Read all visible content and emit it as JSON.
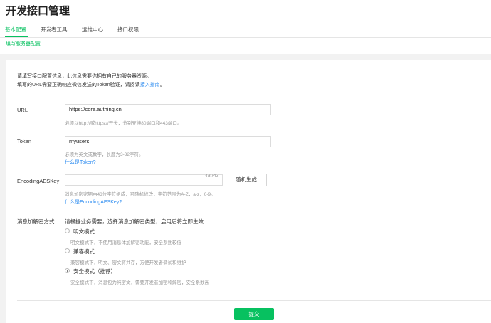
{
  "page": {
    "title": "开发接口管理"
  },
  "tabs": [
    {
      "label": "基本配置"
    },
    {
      "label": "开发者工具"
    },
    {
      "label": "运维中心"
    },
    {
      "label": "接口权限"
    }
  ],
  "subnav": {
    "label": "填写服务器配置"
  },
  "intro": {
    "line1": "请填写接口配置信息，此信息需要你拥有自己的服务器资源。",
    "line2_prefix": "填写的URL需要正确响应微信发送的Token验证，请阅读",
    "line2_link": "接入指南",
    "line2_suffix": "。"
  },
  "url": {
    "label": "URL",
    "value": "https://core.authing.cn",
    "help": "必须以http://或https://开头，分别支持80端口和443端口。"
  },
  "token": {
    "label": "Token",
    "value": "myusers",
    "help": "必须为英文或数字，长度为3-32字符。",
    "link": "什么是Token?"
  },
  "aes": {
    "label": "EncodingAESKey",
    "value": "",
    "count": "43 /43",
    "generate_label": "随机生成",
    "help": "消息加密密钥由43位字符组成，可随机修改，字符范围为A-Z，a-z，0-9。",
    "link": "什么是EncodingAESKey?"
  },
  "encryption": {
    "label": "消息加解密方式",
    "description": "请根据业务需要，选择消息加解密类型，启用后将立即生效",
    "options": [
      {
        "label": "明文模式",
        "help": "明文模式下，不使用消息体加解密功能，安全系数较低",
        "checked": false
      },
      {
        "label": "兼容模式",
        "help": "兼容模式下，明文、密文将共存，方便开发者调试和维护",
        "checked": false
      },
      {
        "label": "安全模式（推荐）",
        "help": "安全模式下，消息包为纯密文，需要开发者加密和解密，安全系数高",
        "checked": true
      }
    ]
  },
  "submit": {
    "label": "提交"
  },
  "colors": {
    "accent": "#07c160",
    "link": "#2d8cf0"
  }
}
